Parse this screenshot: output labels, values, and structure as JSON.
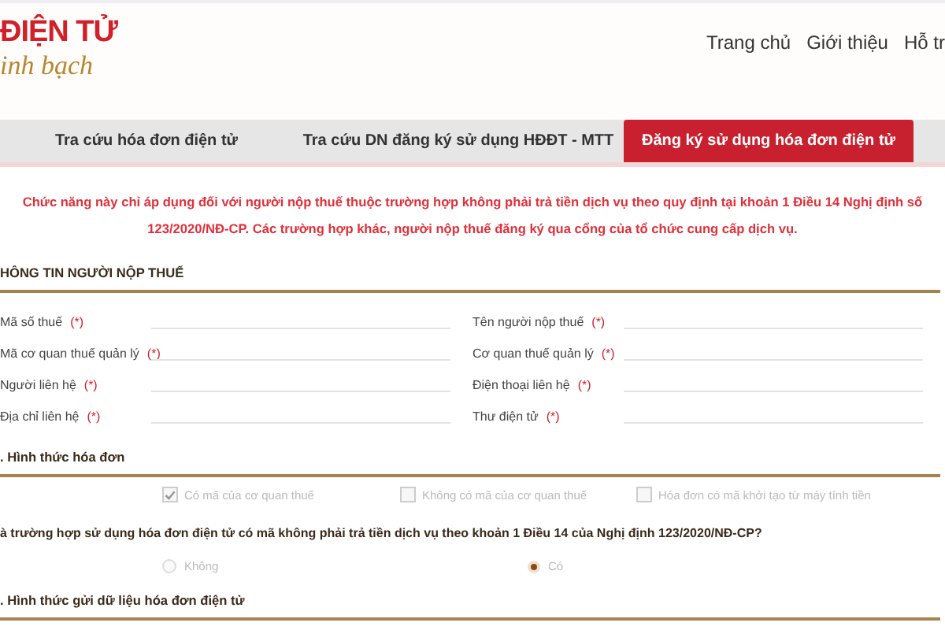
{
  "logo": {
    "title": "ĐIỆN TỬ",
    "tagline": "inh bạch"
  },
  "nav": [
    "Trang chủ",
    "Giới thiệu",
    "Hỗ tr"
  ],
  "tabs": [
    {
      "label": "Tra cứu hóa đơn điện tử",
      "selected": false
    },
    {
      "label": "Tra cứu DN đăng ký sử dụng HĐĐT - MTT",
      "selected": false
    },
    {
      "label": "Đăng ký sử dụng hóa đơn điện tử",
      "selected": true
    }
  ],
  "notice": "Chức năng này chỉ áp dụng đối với người nộp thuế thuộc trường hợp không phải trả tiền dịch vụ theo quy định tại khoản 1 Điều 14 Nghị định số 123/2020/NĐ-CP. Các trường hợp khác, người nộp thuế đăng ký qua cổng của tổ chức cung cấp dịch vụ.",
  "taxpayer_section": {
    "title": "HÔNG TIN NGƯỜI NỘP THUẾ",
    "required_mark": "(*)",
    "fields": [
      {
        "label": "Mã số thuế"
      },
      {
        "label": "Tên người nộp thuế"
      },
      {
        "label": "Mã cơ quan thuế quản lý"
      },
      {
        "label": "Cơ quan thuế quản lý"
      },
      {
        "label": "Người liên hệ"
      },
      {
        "label": "Điện thoại liên hệ"
      },
      {
        "label": "Địa chỉ liên hệ"
      },
      {
        "label": "Thư điện tử"
      }
    ]
  },
  "invoice_form_section": {
    "title": ". Hình thức hóa đơn",
    "options": [
      {
        "label": "Có mã của cơ quan thuế",
        "checked": true,
        "disabled": true
      },
      {
        "label": "Không có mã của cơ quan thuế",
        "checked": false,
        "disabled": true
      },
      {
        "label": "Hóa đơn có mã khởi tạo từ máy tính tiền",
        "checked": false,
        "disabled": true
      }
    ],
    "question": "à trường hợp sử dụng hóa đơn điện tử có mã không phải trả tiền dịch vụ theo khoản 1 Điều 14 của Nghị định 123/2020/NĐ-CP?",
    "answers": [
      {
        "label": "Không",
        "selected": false
      },
      {
        "label": "Có",
        "selected": true
      }
    ]
  },
  "data_send_section": {
    "title": ". Hình thức gửi dữ liệu hóa đơn điện tử"
  }
}
